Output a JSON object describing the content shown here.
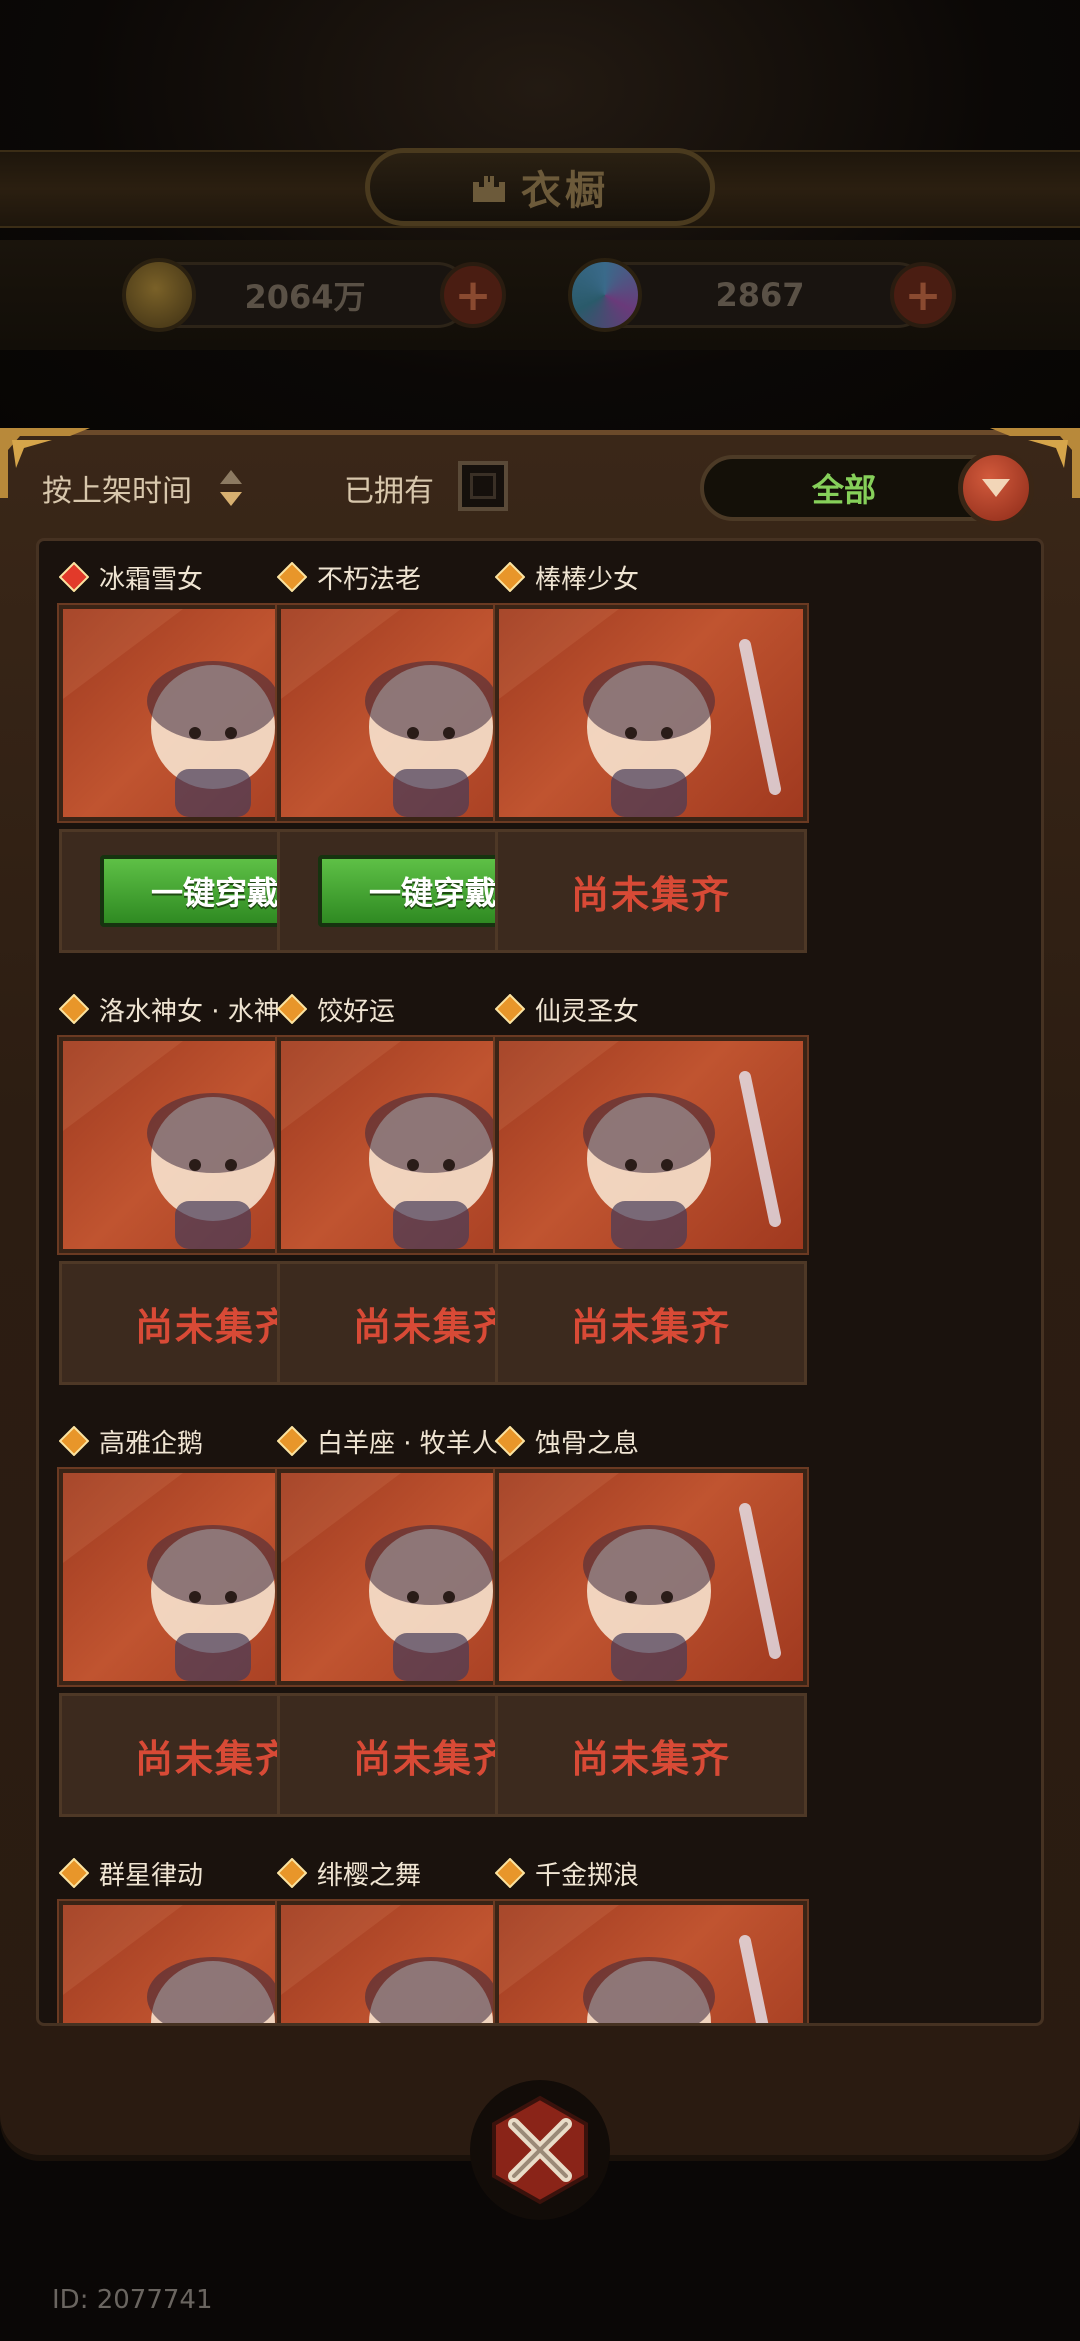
{
  "header": {
    "title": "衣橱"
  },
  "currency": {
    "gold": {
      "value": "2064万",
      "icon": "gold-coin-icon"
    },
    "gem": {
      "value": "2867",
      "icon": "gem-icon"
    }
  },
  "toolbar": {
    "sort_label": "按上架时间",
    "owned_label": "已拥有",
    "owned_checked": false,
    "filter_value": "全部"
  },
  "outfits": [
    {
      "name": "冰霜雪女",
      "action": "一键穿戴",
      "collected": true,
      "rarity_color": "#e23a2a"
    },
    {
      "name": "不朽法老",
      "action": "一键穿戴",
      "collected": true,
      "rarity_color": "#e8962a"
    },
    {
      "name": "棒棒少女",
      "action": "尚未集齐",
      "collected": false,
      "rarity_color": "#e8962a"
    },
    {
      "name": "洛水神女 · 水神",
      "action": "尚未集齐",
      "collected": false,
      "rarity_color": "#e8962a"
    },
    {
      "name": "饺好运",
      "action": "尚未集齐",
      "collected": false,
      "rarity_color": "#e8962a"
    },
    {
      "name": "仙灵圣女",
      "action": "尚未集齐",
      "collected": false,
      "rarity_color": "#e8962a"
    },
    {
      "name": "高雅企鹅",
      "action": "尚未集齐",
      "collected": false,
      "rarity_color": "#e8962a"
    },
    {
      "name": "白羊座 · 牧羊人",
      "action": "尚未集齐",
      "collected": false,
      "rarity_color": "#e8962a"
    },
    {
      "name": "蚀骨之息",
      "action": "尚未集齐",
      "collected": false,
      "rarity_color": "#e8962a"
    },
    {
      "name": "群星律动",
      "action": "",
      "collected": false,
      "rarity_color": "#e8962a"
    },
    {
      "name": "绯樱之舞",
      "action": "",
      "collected": false,
      "rarity_color": "#e8962a"
    },
    {
      "name": "千金掷浪",
      "action": "",
      "collected": false,
      "rarity_color": "#e8962a"
    }
  ],
  "footer": {
    "user_id": "ID: 2077741"
  }
}
